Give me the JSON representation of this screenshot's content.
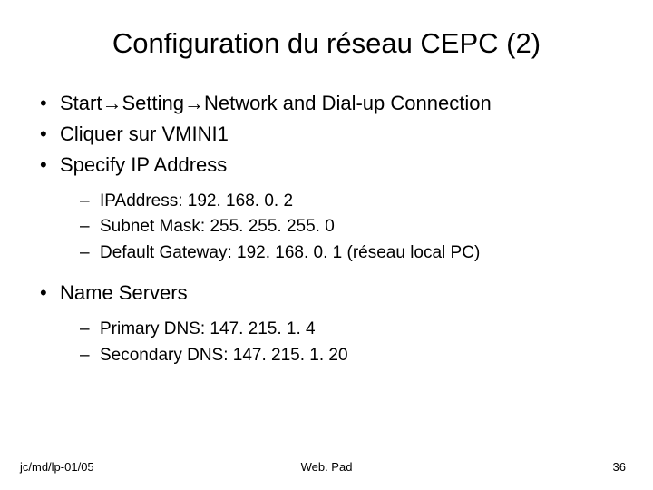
{
  "title": "Configuration du réseau CEPC (2)",
  "bullets": {
    "b1": "Start→Setting→Network and Dial-up Connection",
    "b2": "Cliquer sur VMINI1",
    "b3": "Specify IP Address",
    "b3_sub": {
      "s1": "IPAddress: 192. 168. 0. 2",
      "s2": "Subnet Mask: 255. 255. 255. 0",
      "s3": "Default Gateway: 192. 168. 0. 1 (réseau local PC)"
    },
    "b4": "Name Servers",
    "b4_sub": {
      "s1": "Primary DNS:  147. 215. 1. 4",
      "s2": "Secondary DNS: 147. 215. 1. 20"
    }
  },
  "footer": {
    "left": "jc/md/lp-01/05",
    "center": "Web. Pad",
    "right": "36"
  }
}
